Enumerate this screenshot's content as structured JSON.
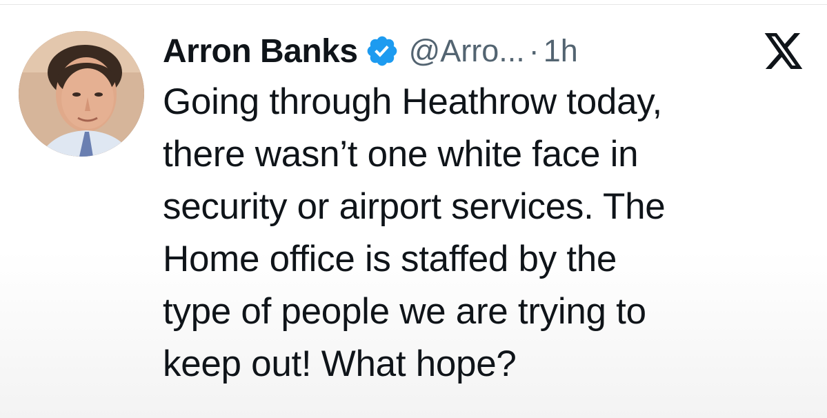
{
  "tweet": {
    "author": {
      "display_name": "Arron Banks",
      "handle": "@Arro...",
      "verified": true,
      "avatar_icon": "profile-photo"
    },
    "separator": "·",
    "time": "1h",
    "platform_icon": "x-logo-icon",
    "text_lines": [
      "Going through Heathrow today,",
      "there wasn’t one white face in",
      "security or airport services. The",
      "Home office is staffed by the",
      "type of people we are trying to",
      "keep out! What hope?"
    ]
  },
  "colors": {
    "verified_blue": "#1d9bf0",
    "text_primary": "#0f1419",
    "text_secondary": "#536471"
  }
}
